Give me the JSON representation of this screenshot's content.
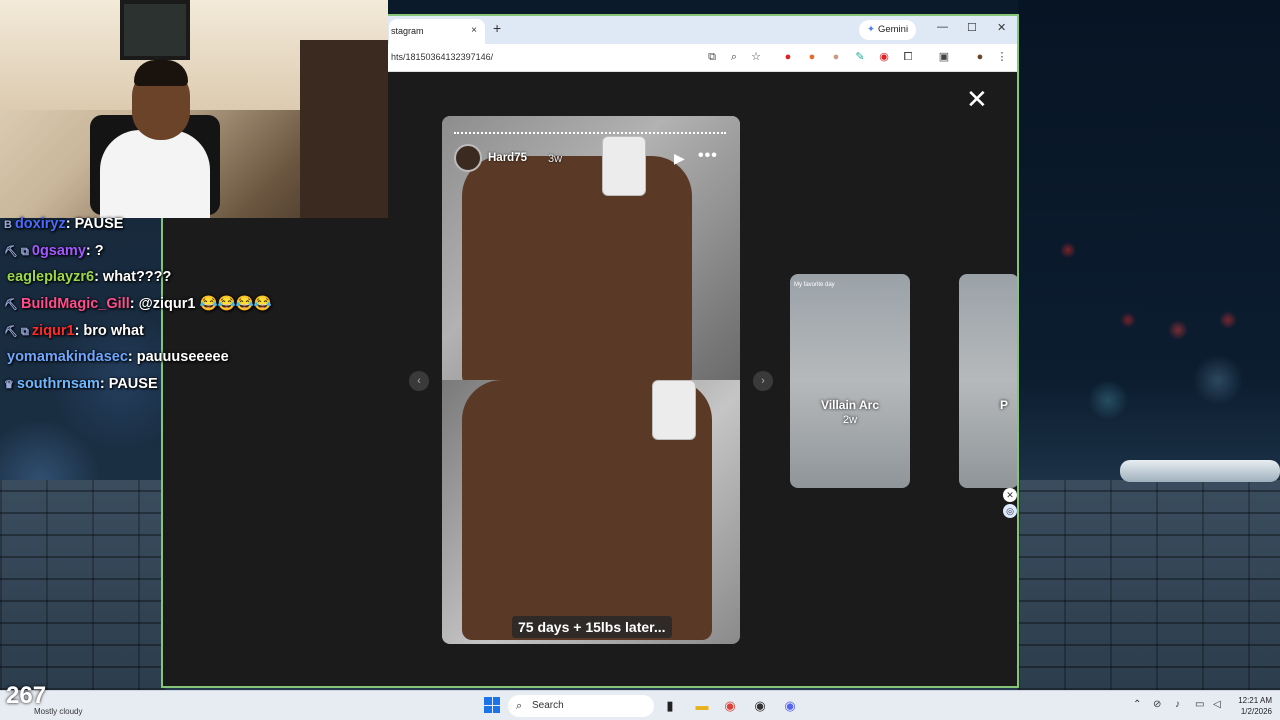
{
  "chat": [
    {
      "badge": "B",
      "user": "doxiryz",
      "user_color": "#4a6bff",
      "message": ": PAUSE"
    },
    {
      "badge": "⛏ ⧉",
      "user": "0gsamy",
      "user_color": "#a259ff",
      "message": ": ?"
    },
    {
      "badge": "",
      "user": "eagleplayzr6",
      "user_color": "#9ad84a",
      "message": ": what????"
    },
    {
      "badge": "⛏",
      "user": "BuildMagic_Gill",
      "user_color": "#ff4d8d",
      "message": ": @ziqur1 😂😂😂😂"
    },
    {
      "badge": "⛏ ⧉",
      "user": "ziqur1",
      "user_color": "#ff2b2b",
      "message": ": bro what"
    },
    {
      "badge": "",
      "user": "yomamakindasec",
      "user_color": "#6fa7ff",
      "message": ": pauuuseeeee"
    },
    {
      "badge": "♛",
      "user": "southrnsam",
      "user_color": "#6fb8ff",
      "message": ": PAUSE"
    }
  ],
  "browser": {
    "tab_title": "stagram",
    "tab_close": "×",
    "new_tab": "+",
    "gemini_label": "Gemini",
    "url": "hts/18150364132397146/",
    "minimize": "—",
    "maximize": "☐",
    "close": "✕"
  },
  "story": {
    "username": "Hard75",
    "time": "3w",
    "caption": "75 days + 15lbs later...",
    "close": "✕",
    "prev": "‹",
    "next": "›"
  },
  "thumbnails": [
    {
      "name": "Villain Arc",
      "time": "2w",
      "tag": "My favorite day"
    },
    {
      "name": "P",
      "time": "",
      "tag": ""
    }
  ],
  "overlay": {
    "viewer_count": "267",
    "weather": "Mostly cloudy"
  },
  "taskbar": {
    "search_placeholder": "Search",
    "time": "12:21 AM",
    "date": "1/2/2026"
  },
  "icons": {
    "tab_close": "close-icon",
    "gemini": "sparkle-icon",
    "search": "search-icon"
  }
}
